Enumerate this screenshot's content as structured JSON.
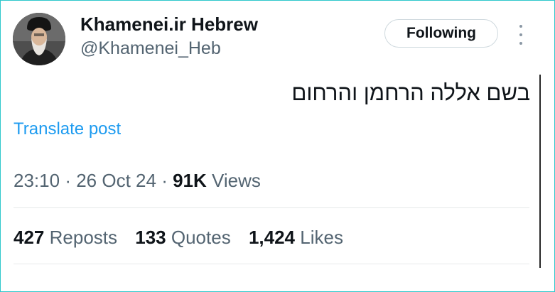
{
  "author": {
    "display_name": "Khamenei.ir Hebrew",
    "handle": "@Khamenei_Heb"
  },
  "header": {
    "follow_label": "Following",
    "more_icon": "more-vertical-icon"
  },
  "tweet": {
    "text": "בשם אללה הרחמן והרחום",
    "translate_label": "Translate post"
  },
  "meta": {
    "time": "23:10",
    "date": "26 Oct 24",
    "separator": "·",
    "views_count": "91K",
    "views_label": "Views"
  },
  "stats": {
    "reposts_count": "427",
    "reposts_label": "Reposts",
    "quotes_count": "133",
    "quotes_label": "Quotes",
    "likes_count": "1,424",
    "likes_label": "Likes"
  },
  "colors": {
    "frame_border": "#2ec8cc",
    "link": "#1d9bf0",
    "text_primary": "#0f1419",
    "text_secondary": "#536471"
  }
}
